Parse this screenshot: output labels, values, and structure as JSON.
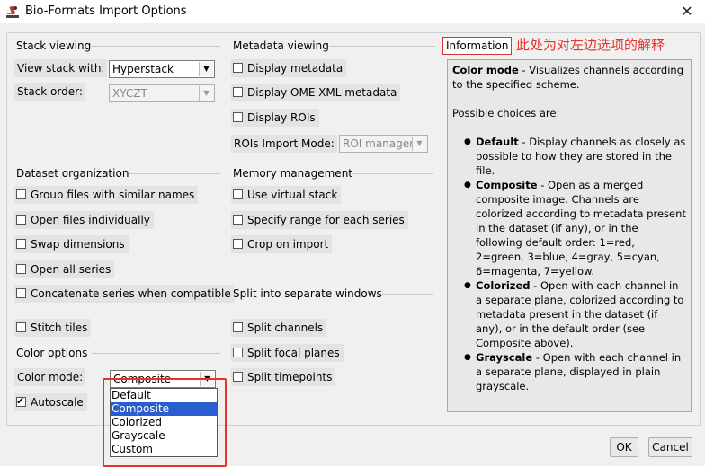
{
  "window": {
    "title": "Bio-Formats Import Options",
    "close_symbol": "✕"
  },
  "stack_viewing": {
    "header": "Stack viewing",
    "view_stack_label": "View stack with:",
    "view_stack_value": "Hyperstack",
    "stack_order_label": "Stack order:",
    "stack_order_value": "XYCZT"
  },
  "metadata_viewing": {
    "header": "Metadata viewing",
    "display_metadata": "Display metadata",
    "display_omexml": "Display OME-XML metadata",
    "display_rois": "Display ROIs",
    "rois_mode_label": "ROIs Import Mode:",
    "rois_mode_value": "ROI manager"
  },
  "dataset_organization": {
    "header": "Dataset organization",
    "group_files": "Group files with similar names",
    "open_individually": "Open files individually",
    "swap_dimensions": "Swap dimensions",
    "open_all_series": "Open all series",
    "concatenate": "Concatenate series when compatible",
    "stitch_tiles": "Stitch tiles"
  },
  "memory_management": {
    "header": "Memory management",
    "virtual_stack": "Use virtual stack",
    "specify_range": "Specify range for each series",
    "crop_on_import": "Crop on import"
  },
  "split_windows": {
    "header": "Split into separate windows",
    "split_channels": "Split channels",
    "split_focal": "Split focal planes",
    "split_timepoints": "Split timepoints"
  },
  "color_options": {
    "header": "Color options",
    "color_mode_label": "Color mode:",
    "color_mode_value": "Composite",
    "autoscale": "Autoscale",
    "autoscale_checked": true,
    "dropdown_options": [
      "Default",
      "Composite",
      "Colorized",
      "Grayscale",
      "Custom"
    ],
    "selected_index": 1
  },
  "information": {
    "tab_label": "Information",
    "annotation_note": "此处为对左边选项的解释",
    "title": "Color mode",
    "intro": " - Visualizes channels according to the specified scheme.",
    "possible": "Possible choices are:",
    "choices": [
      {
        "name": "Default",
        "desc": " - Display channels as closely as possible to how they are stored in the file."
      },
      {
        "name": "Composite",
        "desc": " - Open as a merged composite image. Channels are colorized according to metadata present in the dataset (if any), or in the following default order: 1=red, 2=green, 3=blue, 4=gray, 5=cyan, 6=magenta, 7=yellow."
      },
      {
        "name": "Colorized",
        "desc": " - Open with each channel in a separate plane, colorized according to metadata present in the dataset (if any), or in the default order (see Composite above)."
      },
      {
        "name": "Grayscale",
        "desc": " - Open with each channel in a separate plane, displayed in plain grayscale."
      }
    ]
  },
  "buttons": {
    "ok": "OK",
    "cancel": "Cancel"
  }
}
